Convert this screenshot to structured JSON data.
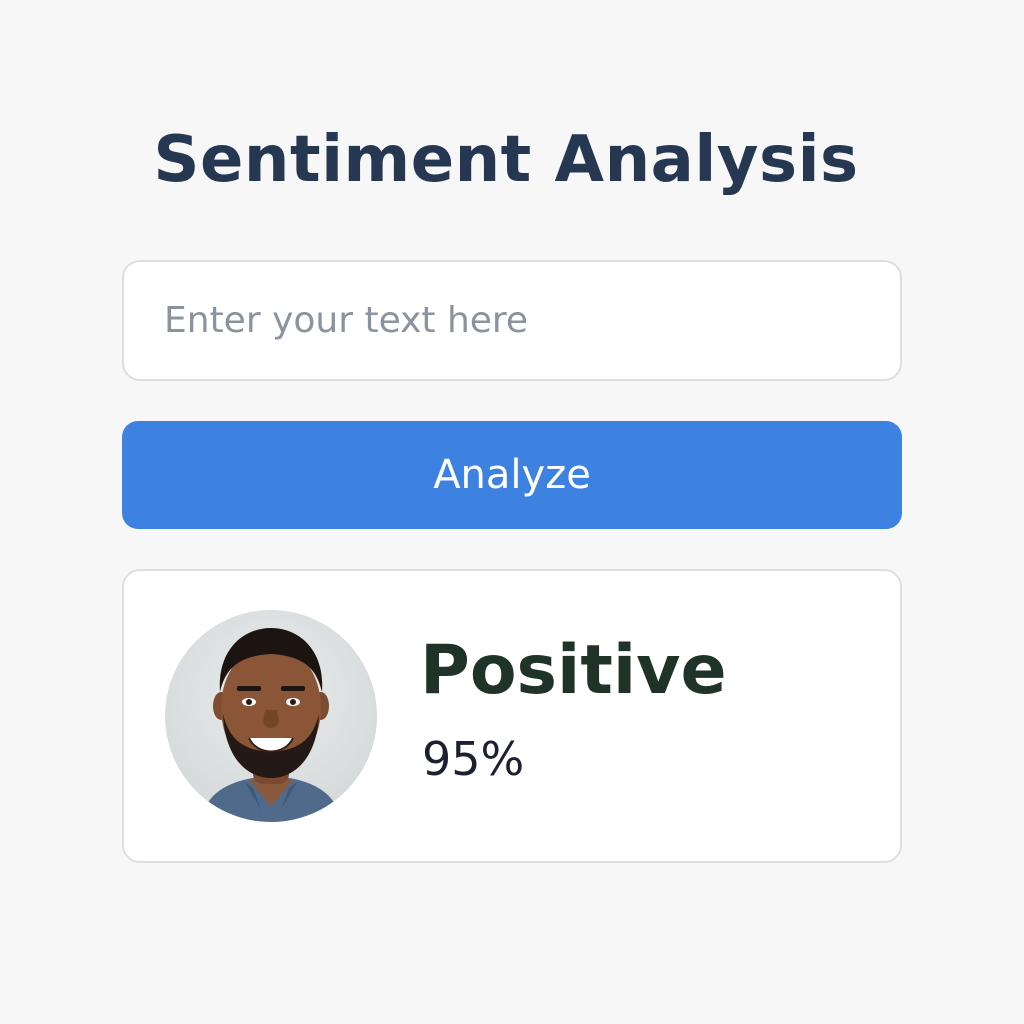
{
  "page": {
    "title": "Sentiment Analysis"
  },
  "input": {
    "placeholder": "Enter your text here",
    "value": ""
  },
  "actions": {
    "analyze_label": "Analyze"
  },
  "result": {
    "sentiment": "Positive",
    "confidence": "95%",
    "confidence_fraction": 0.95,
    "avatar_icon": "person-avatar"
  },
  "colors": {
    "title": "#263752",
    "accent": "#3d82e0",
    "sentiment_text": "#1f3329"
  }
}
